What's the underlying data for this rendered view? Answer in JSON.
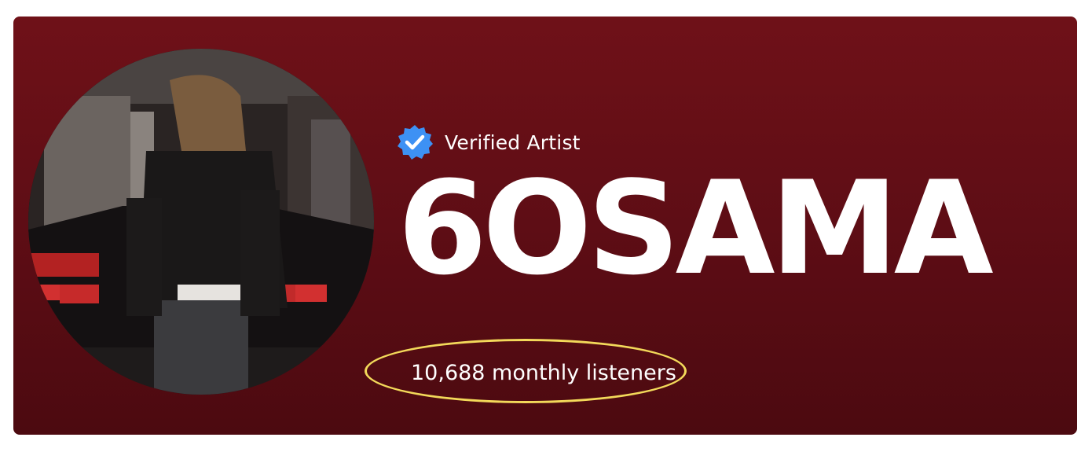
{
  "artist": {
    "verified_label": "Verified Artist",
    "name": "6OSAMA",
    "monthly_listeners": "10,688 monthly listeners"
  },
  "icons": {
    "verified": "verified-check-badge-icon"
  },
  "colors": {
    "header_background": "#6f1118",
    "verified_badge": "#3d91f4",
    "text": "#ffffff",
    "annotation_circle": "#f3d95a"
  }
}
